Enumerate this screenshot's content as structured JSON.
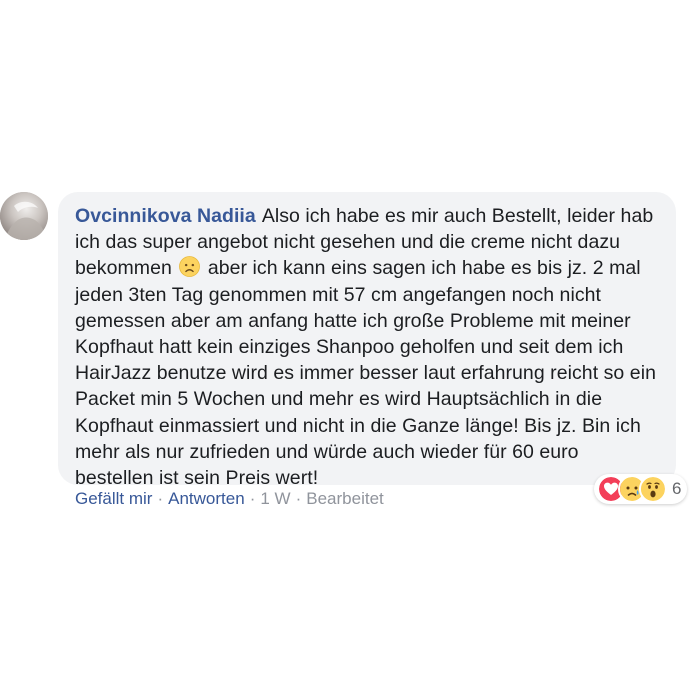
{
  "comment": {
    "author": "Ovcinnikova Nadiia",
    "text_part1": "Also ich habe es mir auch Bestellt, leider hab ich das super angebot nicht gesehen und die creme nicht dazu bekommen",
    "text_part2": "aber ich kann eins sagen ich habe es bis jz. 2 mal jeden 3ten Tag genommen mit 57 cm angefangen noch nicht gemessen aber am anfang hatte ich große Probleme mit meiner Kopfhaut hatt kein einziges Shanpoo geholfen und seit dem ich HairJazz benutze wird es immer besser laut erfahrung reicht so ein Packet min 5 Wochen und mehr es wird Hauptsächlich in die Kopfhaut einmassiert und nicht in die Ganze länge! Bis jz. Bin ich mehr als nur zufrieden und würde auch wieder für 60 euro bestellen ist sein Preis wert!",
    "inline_emoji": "sad-face-emoji"
  },
  "reactions": {
    "icons": [
      "love-reaction-icon",
      "sad-reaction-icon",
      "wow-reaction-icon"
    ],
    "count": "6"
  },
  "actions": {
    "like": "Gefällt mir",
    "reply": "Antworten",
    "separator": "·",
    "time": "1 W",
    "edited": "Bearbeitet"
  },
  "colors": {
    "author": "#385898",
    "bubble": "#f2f3f5",
    "meta": "#90949c",
    "love": "#f33e58",
    "emoji_yellow": "#fcd35f"
  }
}
